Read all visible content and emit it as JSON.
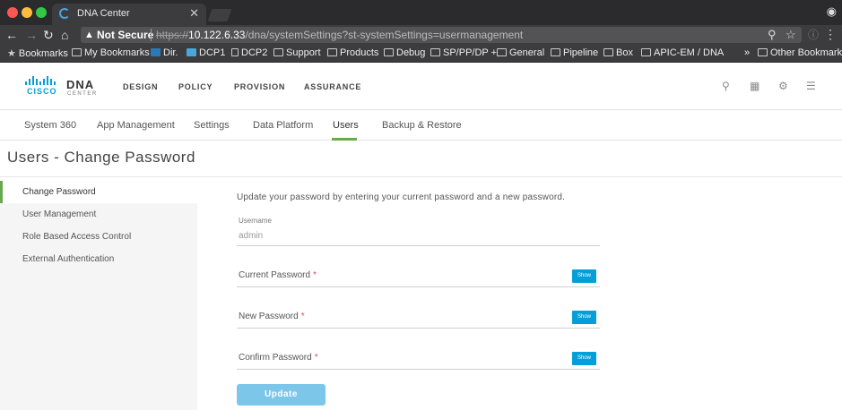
{
  "browser": {
    "tab_title": "DNA Center",
    "tab_close": "✕",
    "security_label": "Not Secure",
    "url_scheme": "https://",
    "url_host": "10.122.6.33",
    "url_path": "/dna/systemSettings?st-systemSettings=usermanagement",
    "bookmarks": [
      {
        "label": "Bookmarks",
        "icon": "star-icon"
      },
      {
        "label": "My Bookmarks",
        "icon": "folder-icon"
      },
      {
        "label": "Dir.",
        "icon": "favicon-icon"
      },
      {
        "label": "DCP1",
        "icon": "favicon-icon"
      },
      {
        "label": "DCP2",
        "icon": "page-icon"
      },
      {
        "label": "Support",
        "icon": "folder-icon"
      },
      {
        "label": "Products",
        "icon": "folder-icon"
      },
      {
        "label": "Debug",
        "icon": "folder-icon"
      },
      {
        "label": "SP/PP/DP +",
        "icon": "folder-icon"
      },
      {
        "label": "General",
        "icon": "folder-icon"
      },
      {
        "label": "Pipeline",
        "icon": "folder-icon"
      },
      {
        "label": "Box",
        "icon": "folder-icon"
      },
      {
        "label": "APIC-EM / DNA",
        "icon": "folder-icon"
      }
    ],
    "overflow_label": "»",
    "other_bookmarks": "Other Bookmarks"
  },
  "header": {
    "logo_word": "DNA",
    "logo_sub": "CENTER",
    "logo_brand": "CISCO",
    "nav": [
      "DESIGN",
      "POLICY",
      "PROVISION",
      "ASSURANCE"
    ]
  },
  "subtabs": [
    "System 360",
    "App Management",
    "Settings",
    "Data Platform",
    "Users",
    "Backup & Restore"
  ],
  "active_subtab": "Users",
  "page_title": "Users - Change Password",
  "left_menu": [
    "Change Password",
    "User Management",
    "Role Based Access Control",
    "External Authentication"
  ],
  "form": {
    "intro": "Update your password by entering your current password and a new password.",
    "username_label": "Username",
    "username_value": "admin",
    "current_password_label": "Current Password",
    "new_password_label": "New Password",
    "confirm_password_label": "Confirm Password",
    "required_marker": "*",
    "show_label": "Show",
    "update_label": "Update"
  },
  "colors": {
    "accent_green": "#6aa84f",
    "brand_blue": "#049fd9",
    "update_button": "#7cc6ea"
  }
}
